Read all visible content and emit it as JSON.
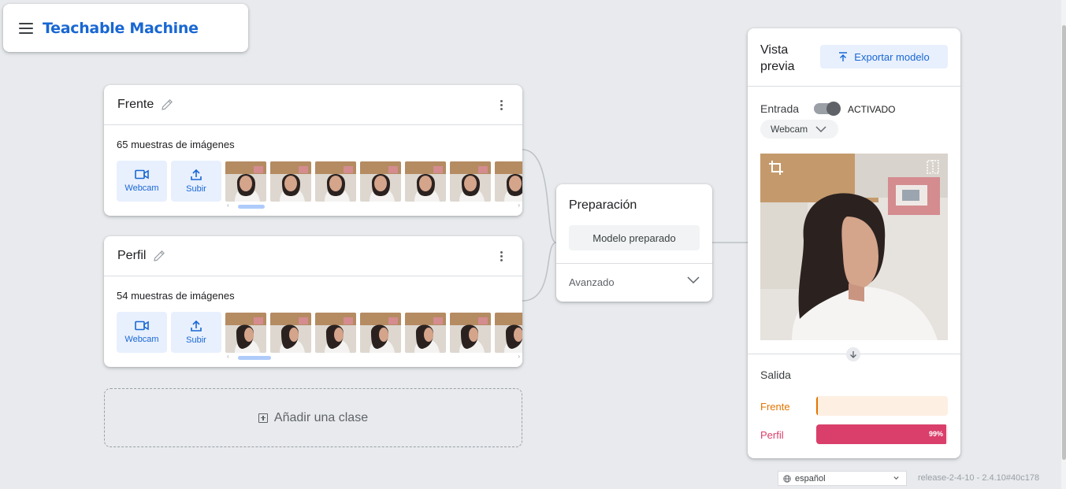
{
  "header": {
    "title": "Teachable Machine",
    "menu_icon": "menu-icon"
  },
  "classes": [
    {
      "name": "Frente",
      "sample_count": "65 muestras de imágenes",
      "buttons": {
        "webcam": "Webcam",
        "upload": "Subir"
      },
      "thumbnail_count": 7,
      "scroll_position": 0.0
    },
    {
      "name": "Perfil",
      "sample_count": "54 muestras de imágenes",
      "buttons": {
        "webcam": "Webcam",
        "upload": "Subir"
      },
      "thumbnail_count": 7,
      "scroll_position": 0.0
    }
  ],
  "add_class": {
    "label": "Añadir una clase"
  },
  "training": {
    "title": "Preparación",
    "button": "Modelo preparado",
    "advanced": "Avanzado"
  },
  "preview": {
    "title": "Vista previa",
    "export_button": "Exportar modelo",
    "input_label": "Entrada",
    "toggle_state": "ACTIVADO",
    "toggle_on": true,
    "source": "Webcam",
    "output_label": "Salida",
    "outputs": [
      {
        "label": "Frente",
        "percent": 1,
        "show_percent": "",
        "color": "#e37400",
        "bg": "#feefe3"
      },
      {
        "label": "Perfil",
        "percent": 99,
        "show_percent": "99%",
        "color": "#d93f6a",
        "bg": "#fce8ee"
      }
    ]
  },
  "footer": {
    "language": "español",
    "release": "release-2-4-10 - 2.4.10#40c178"
  },
  "colors": {
    "accent": "#1967d2",
    "accent_bg": "#e8f0fe",
    "page_bg": "#e8eaed"
  }
}
